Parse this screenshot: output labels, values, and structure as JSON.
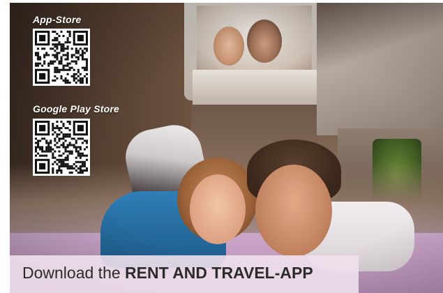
{
  "app_store": {
    "label": "App-Store",
    "qr_icon": "qr-code-icon"
  },
  "play_store": {
    "label": "Google Play Store",
    "qr_icon": "qr-code-icon"
  },
  "banner": {
    "prefix": "Download the",
    "emphasis": "RENT AND TRAVEL-APP"
  },
  "colors": {
    "banner_background": "#f0e0ec",
    "label_text": "#ffffff",
    "banner_text": "#2b2b2b"
  }
}
